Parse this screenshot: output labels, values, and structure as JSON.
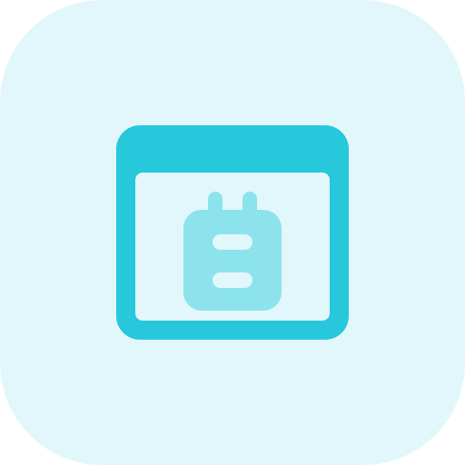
{
  "icon": {
    "name": "browser-calendar-icon",
    "colors": {
      "background": "#e2f7fb",
      "primary": "#27c7dc",
      "secondary": "#8ce3ec",
      "inner": "#e2f7fb"
    }
  }
}
